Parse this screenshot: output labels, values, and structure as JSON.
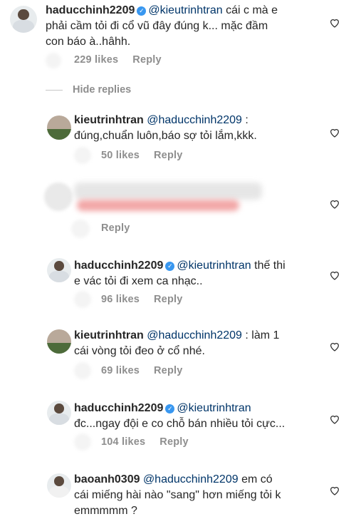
{
  "comments": [
    {
      "username": "haducchinh2209",
      "verified": true,
      "mention": "@kieutrinhtran",
      "text_line1": " cái c mà e",
      "text_line2": "phải cầm tỏi đi cổ vũ đây đúng k... mặc đầm",
      "text_line3": "con báo à..hâhh.",
      "likes": "229 likes",
      "reply": "Reply"
    },
    {
      "username": "kieutrinhtran",
      "mention": "@haducchinh2209",
      "text_line1": " :",
      "text_line2": "đúng,chuẩn luôn,báo sợ tỏi lắm,kkk.",
      "likes": "50 likes",
      "reply": "Reply"
    },
    {
      "reply": "Reply"
    },
    {
      "username": "haducchinh2209",
      "verified": true,
      "mention": "@kieutrinhtran",
      "text_line1": " thế thi",
      "text_line2": "e vác tỏi đi xem ca nhạc..",
      "likes": "96 likes",
      "reply": "Reply"
    },
    {
      "username": "kieutrinhtran",
      "mention": "@haducchinh2209",
      "text_line1": " : làm 1",
      "text_line2": "cái vòng tỏi đeo ở cổ nhé.",
      "likes": "69 likes",
      "reply": "Reply"
    },
    {
      "username": "haducchinh2209",
      "verified": true,
      "mention": "@kieutrinhtran",
      "text_line2": "đc...ngay đội e co chỗ bán nhiều tỏi cực...",
      "likes": "104 likes",
      "reply": "Reply"
    },
    {
      "username": "baoanh0309",
      "mention": "@haducchinh2209",
      "text_line1": " em có",
      "text_line2": "cái miếng hài nào \"sang\" hơn miếng tỏi k",
      "text_line3": "emmmmm ?"
    }
  ],
  "hide_replies": "Hide replies",
  "icons": {
    "heart": "heart-outline-icon",
    "verified": "verified-badge-icon"
  },
  "colors": {
    "mention": "#003569",
    "meta": "#8e8e8e",
    "verified": "#3897f0"
  }
}
